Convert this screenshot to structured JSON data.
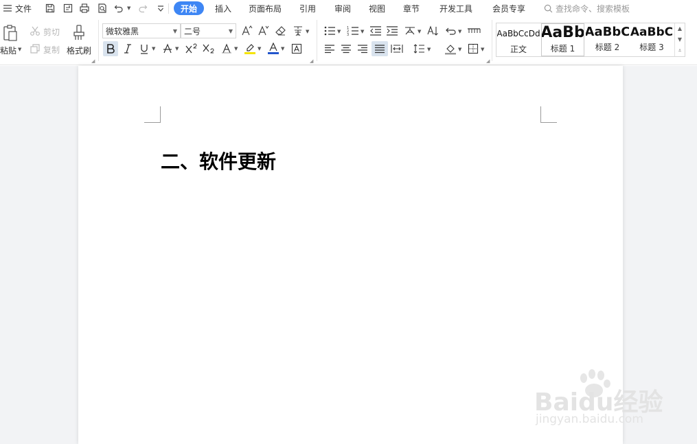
{
  "menubar": {
    "menu_icon": "hamburger-icon",
    "file_label": "文件",
    "quick_icons": [
      "save-icon",
      "export-pdf-icon",
      "print-icon",
      "print-preview-icon",
      "undo-icon",
      "redo-icon",
      "customize-toolbar-icon"
    ],
    "tabs": [
      {
        "label": "开始",
        "active": true
      },
      {
        "label": "插入"
      },
      {
        "label": "页面布局"
      },
      {
        "label": "引用"
      },
      {
        "label": "审阅"
      },
      {
        "label": "视图"
      },
      {
        "label": "章节"
      },
      {
        "label": "开发工具"
      },
      {
        "label": "会员专享"
      }
    ],
    "search_placeholder": "查找命令、搜索模板",
    "accent_color": "#3e86f4"
  },
  "ribbon": {
    "clipboard": {
      "paste_label": "粘贴",
      "cut_label": "剪切",
      "copy_label": "复制",
      "format_painter_label": "格式刷"
    },
    "font": {
      "font_name": "微软雅黑",
      "font_size": "二号",
      "bold_active": true,
      "highlight_color": "#f5e400",
      "font_color": "#2255cc"
    },
    "styles": [
      {
        "preview": "AaBbCcDd",
        "name": "正文"
      },
      {
        "preview": "AaBb",
        "name": "标题 1"
      },
      {
        "preview": "AaBbC",
        "name": "标题 2"
      },
      {
        "preview": "AaBbC",
        "name": "标题 3"
      }
    ]
  },
  "document": {
    "heading": "二、软件更新"
  },
  "watermark": {
    "logo_text": "Baidu经验",
    "url": "jingyan.baidu.com"
  }
}
